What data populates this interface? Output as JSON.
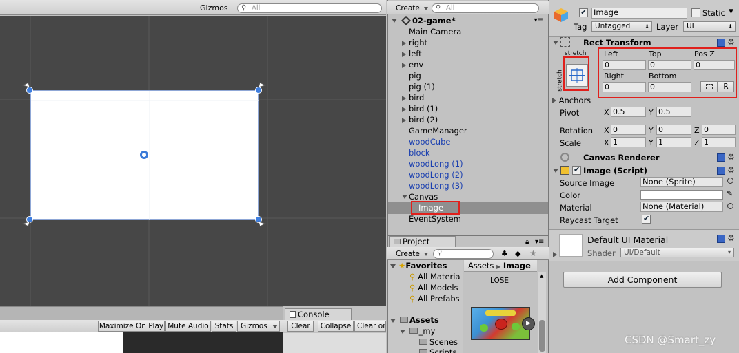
{
  "scene": {
    "gizmos_label": "Gizmos",
    "search_placeholder": "All"
  },
  "game": {
    "maximize": "Maximize On Play",
    "mute": "Mute Audio",
    "stats": "Stats",
    "gizmos": "Gizmos"
  },
  "console": {
    "tab": "Console",
    "clear": "Clear",
    "collapse": "Collapse",
    "clear_on": "Clear or"
  },
  "hierarchy": {
    "create": "Create",
    "search_placeholder": "All",
    "scene_name": "02-game*",
    "items": [
      {
        "label": "Main Camera",
        "indent": 0,
        "arrow": false,
        "prefab": false
      },
      {
        "label": "right",
        "indent": 0,
        "arrow": true,
        "prefab": false
      },
      {
        "label": "left",
        "indent": 0,
        "arrow": true,
        "prefab": false
      },
      {
        "label": "env",
        "indent": 0,
        "arrow": true,
        "prefab": false
      },
      {
        "label": "pig",
        "indent": 0,
        "arrow": false,
        "prefab": false
      },
      {
        "label": "pig (1)",
        "indent": 0,
        "arrow": false,
        "prefab": false
      },
      {
        "label": "bird",
        "indent": 0,
        "arrow": true,
        "prefab": false
      },
      {
        "label": "bird (1)",
        "indent": 0,
        "arrow": true,
        "prefab": false
      },
      {
        "label": "bird (2)",
        "indent": 0,
        "arrow": true,
        "prefab": false
      },
      {
        "label": "GameManager",
        "indent": 0,
        "arrow": false,
        "prefab": false
      },
      {
        "label": "woodCube",
        "indent": 0,
        "arrow": false,
        "prefab": true
      },
      {
        "label": "block",
        "indent": 0,
        "arrow": false,
        "prefab": true
      },
      {
        "label": "woodLong (1)",
        "indent": 0,
        "arrow": false,
        "prefab": true
      },
      {
        "label": "woodLong (2)",
        "indent": 0,
        "arrow": false,
        "prefab": true
      },
      {
        "label": "woodLong (3)",
        "indent": 0,
        "arrow": false,
        "prefab": true
      },
      {
        "label": "Canvas",
        "indent": 0,
        "arrow": "down",
        "prefab": false
      },
      {
        "label": "Image",
        "indent": 1,
        "arrow": false,
        "prefab": false,
        "selected": true
      },
      {
        "label": "EventSystem",
        "indent": 0,
        "arrow": false,
        "prefab": false
      }
    ]
  },
  "project": {
    "tab": "Project",
    "create": "Create",
    "favorites": "Favorites",
    "fav_items": [
      "All Materia",
      "All Models",
      "All Prefabs"
    ],
    "assets": "Assets",
    "asset_tree": [
      "_my",
      "Scenes",
      "Scripts"
    ],
    "breadcrumb_root": "Assets",
    "breadcrumb_current": "Image",
    "file_label": "LOSE"
  },
  "inspector": {
    "object_name": "Image",
    "static_label": "Static",
    "tag_label": "Tag",
    "tag_value": "Untagged",
    "layer_label": "Layer",
    "layer_value": "UI",
    "rect_transform": {
      "title": "Rect Transform",
      "stretch_h": "stretch",
      "stretch_v": "stretch",
      "left_label": "Left",
      "left": "0",
      "top_label": "Top",
      "top": "0",
      "posz_label": "Pos Z",
      "posz": "0",
      "right_label": "Right",
      "right": "0",
      "bottom_label": "Bottom",
      "bottom": "0",
      "r_button": "R",
      "anchors": "Anchors",
      "pivot_label": "Pivot",
      "pivot_x": "0.5",
      "pivot_y": "0.5",
      "rotation_label": "Rotation",
      "rot_x": "0",
      "rot_y": "0",
      "rot_z": "0",
      "scale_label": "Scale",
      "scale_x": "1",
      "scale_y": "1",
      "scale_z": "1",
      "x": "X",
      "y": "Y",
      "z": "Z"
    },
    "canvas_renderer": "Canvas Renderer",
    "image_script": {
      "title": "Image (Script)",
      "source_label": "Source Image",
      "source_value": "None (Sprite)",
      "color_label": "Color",
      "material_label": "Material",
      "material_value": "None (Material)",
      "raycast_label": "Raycast Target"
    },
    "material": {
      "name": "Default UI Material",
      "shader_label": "Shader",
      "shader_value": "UI/Default"
    },
    "add_component": "Add Component"
  },
  "watermark": "CSDN @Smart_zy"
}
